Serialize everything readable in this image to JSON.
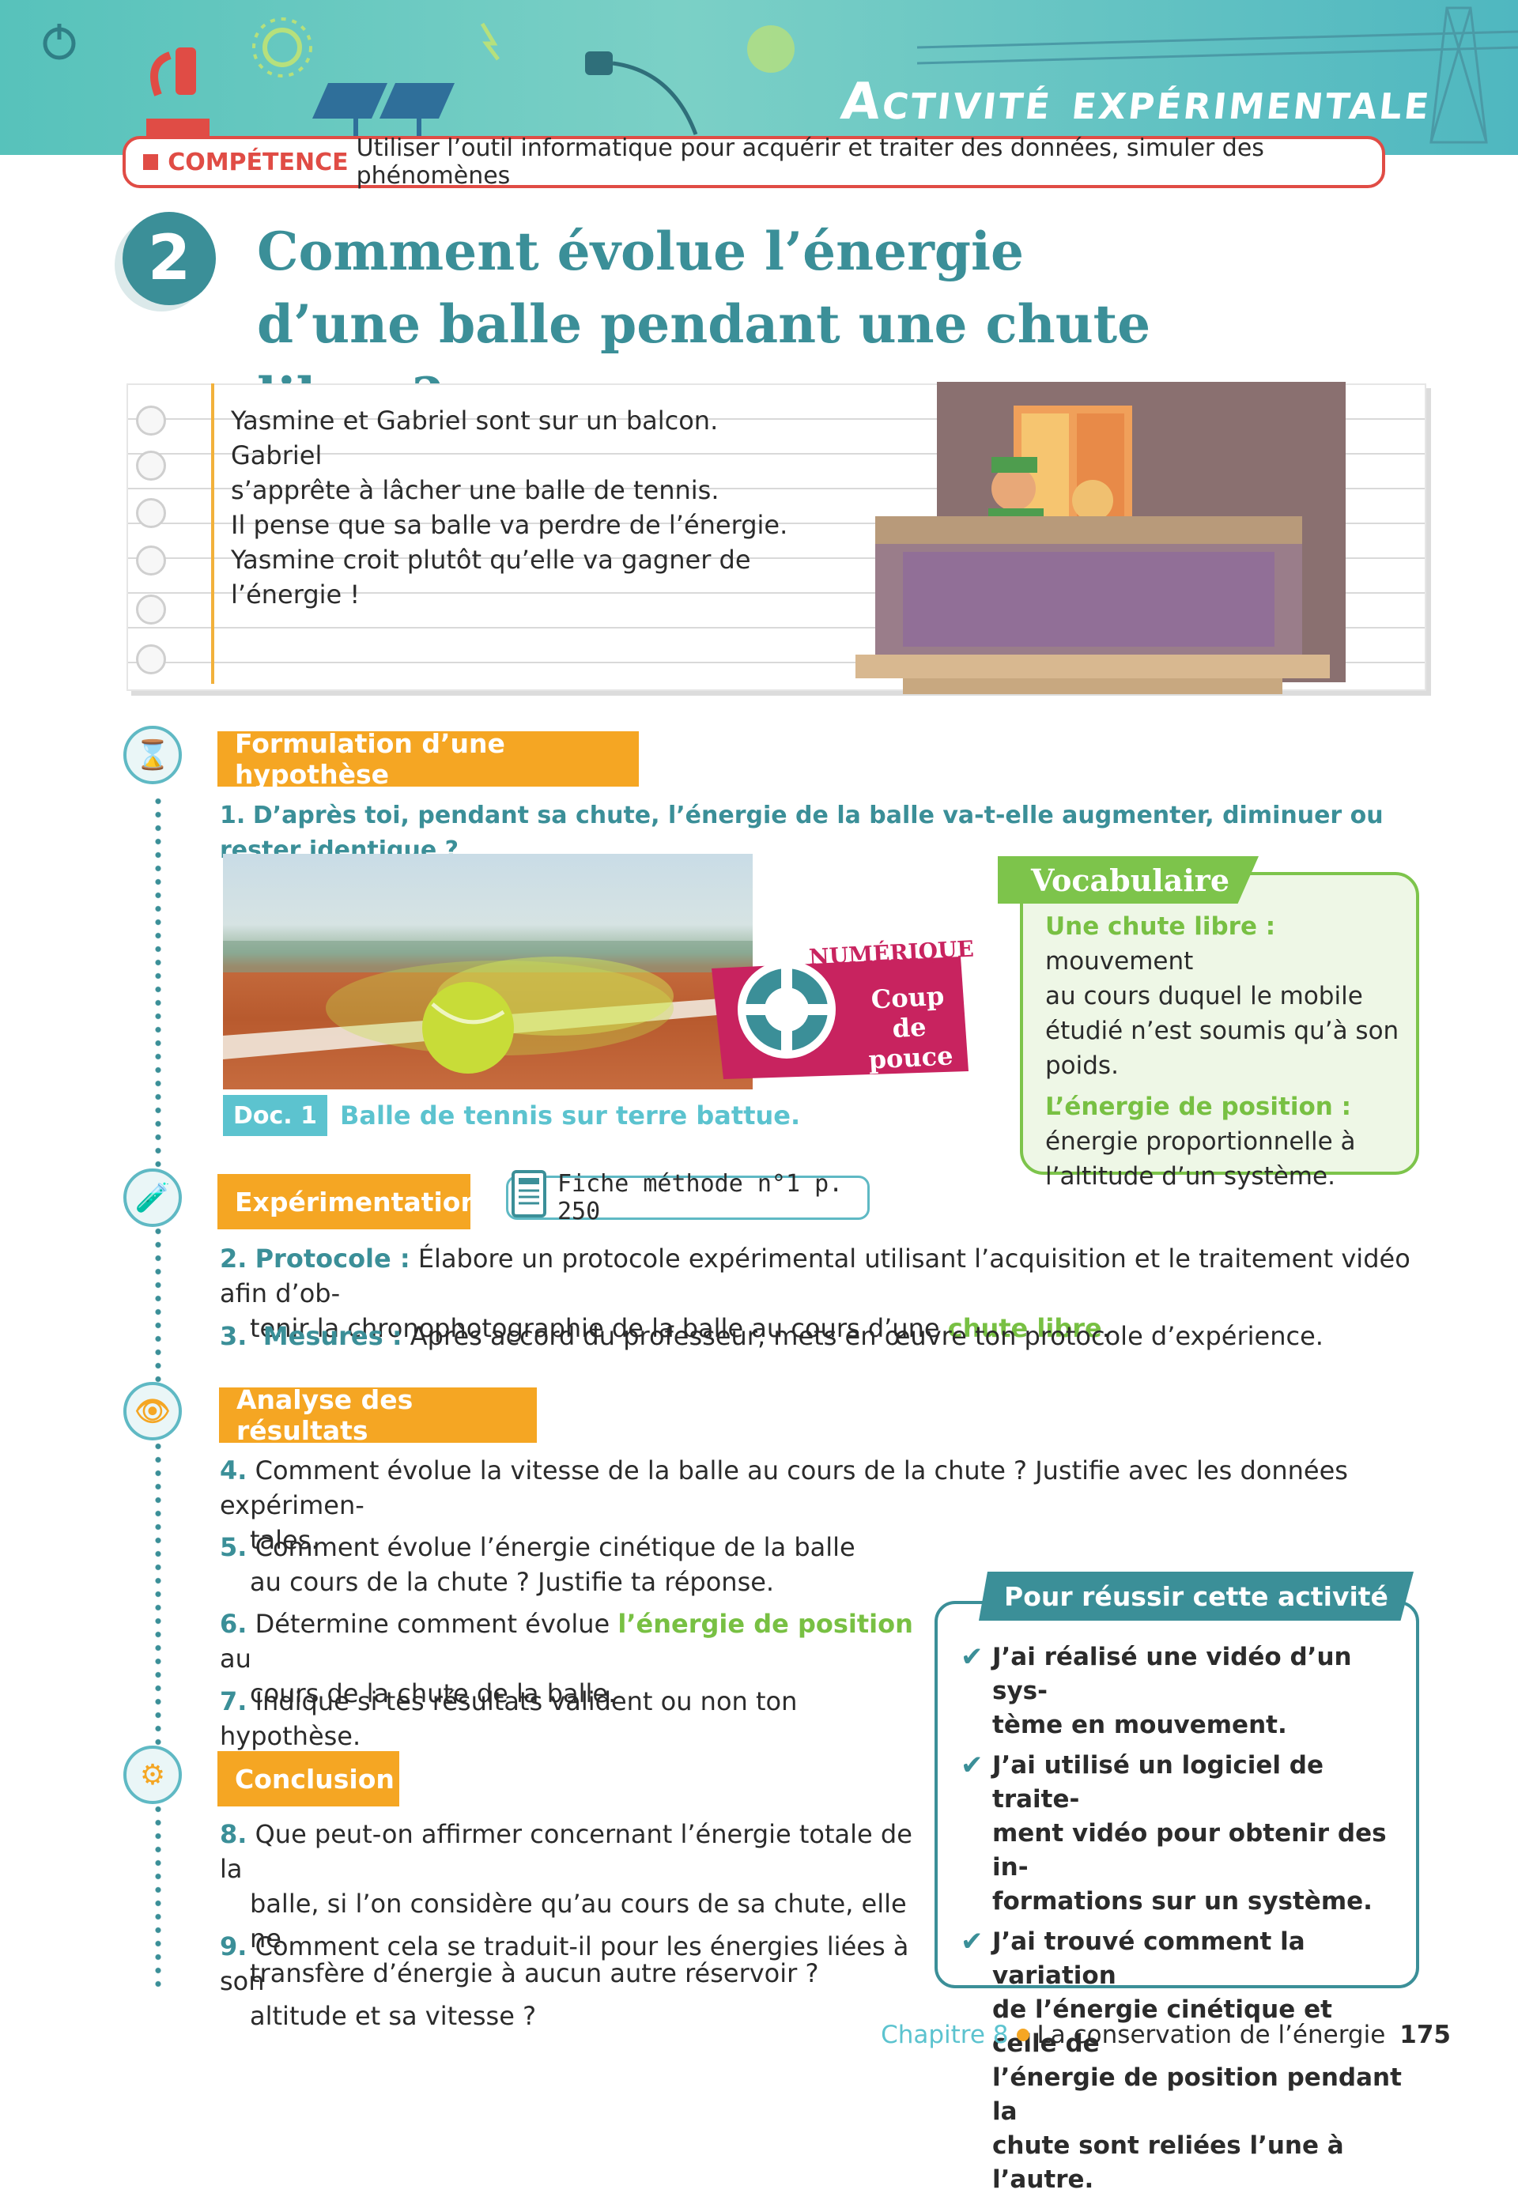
{
  "header": {
    "banner_title": "Activité expérimentale",
    "competence_label": "COMPÉTENCE",
    "competence_text": "Utiliser l’outil informatique pour acquérir et traiter des données, simuler des phénomènes"
  },
  "activity": {
    "number": "2",
    "title_line1": "Comment évolue l’énergie",
    "title_line2": "d’une balle pendant une chute libre ?"
  },
  "intro": {
    "lines": [
      "Yasmine et Gabriel sont sur un balcon. Gabriel",
      "s’apprête à lâcher une balle de tennis.",
      "Il pense que sa balle va perdre de l’énergie.",
      "Yasmine croit plutôt qu’elle va gagner de",
      "l’énergie !"
    ]
  },
  "sections": {
    "hypothesis": {
      "title": "Formulation d’une hypothèse",
      "q1_num": "1.",
      "q1_text": "D’après toi, pendant sa chute, l’énergie de la balle va-t-elle augmenter, diminuer ou rester identique ?"
    },
    "experimentation": {
      "title": "Expérimentation",
      "fiche": "Fiche méthode n°1 p. 250",
      "q2_num": "2.",
      "q2_label": "Protocole :",
      "q2_text_a": " Élabore un protocole expérimental utilisant l’acquisition et le traitement vidéo afin d’ob-",
      "q2_text_b": "tenir la chronophotographie de la balle au cours d’une ",
      "q2_link": "chute libre",
      "q2_end": ".",
      "q3_num": "3.",
      "q3_label": "Mesures :",
      "q3_text": " Après accord du professeur, mets en œuvre ton protocole d’expérience."
    },
    "analysis": {
      "title": "Analyse des résultats",
      "q4_num": "4.",
      "q4_a": "Comment évolue la vitesse de la balle au cours de la chute ? Justifie avec les données expérimen-",
      "q4_b": "tales.",
      "q5_num": "5.",
      "q5_a": "Comment évolue l’énergie cinétique de la balle",
      "q5_b": "au cours de la chute ? Justifie ta réponse.",
      "q6_num": "6.",
      "q6_a": "Détermine comment évolue ",
      "q6_link": "l’énergie de position",
      "q6_b": " au",
      "q6_c": "cours de la chute de la balle.",
      "q7_num": "7.",
      "q7_text": "Indique si tes résultats valident ou non ton hypothèse."
    },
    "conclusion": {
      "title": "Conclusion",
      "q8_num": "8.",
      "q8_a": "Que peut-on affirmer concernant l’énergie totale de la",
      "q8_b": "balle, si l’on considère qu’au cours de sa chute, elle ne",
      "q8_c": "transfère d’énergie à aucun autre réservoir ?",
      "q9_num": "9.",
      "q9_a": "Comment cela se traduit-il pour les énergies liées à son",
      "q9_b": "altitude et sa vitesse ?"
    }
  },
  "doc1": {
    "label": "Doc. 1",
    "caption": "Balle de tennis sur terre battue."
  },
  "numerique": {
    "label": "NUMÉRIQUE",
    "line1": "Coup",
    "line2": "de pouce"
  },
  "vocabulary": {
    "title": "Vocabulaire",
    "term1": "Une chute libre :",
    "def1_a": " mouvement",
    "def1_b": "au cours duquel le mobile",
    "def1_c": "étudié n’est soumis qu’à son",
    "def1_d": "poids.",
    "term2": "L’énergie de position :",
    "def2_a": "énergie proportionnelle à",
    "def2_b": "l’altitude d’un système."
  },
  "success": {
    "title": "Pour réussir cette activité",
    "items": [
      [
        "J’ai réalisé une vidéo d’un sys-",
        "tème en mouvement."
      ],
      [
        "J’ai utilisé un logiciel de traite-",
        "ment vidéo pour obtenir des in-",
        "formations sur un système."
      ],
      [
        "J’ai trouvé comment la variation",
        "de l’énergie cinétique et celle de",
        "l’énergie de position pendant la",
        "chute sont reliées l’une à l’autre."
      ]
    ]
  },
  "footer": {
    "chapter": "Chapitre 8",
    "title": "La conservation de l’énergie",
    "page": "175"
  },
  "colors": {
    "teal": "#3b8f98",
    "orange": "#f5a623",
    "green": "#78c043",
    "red": "#e04c45",
    "light_blue": "#5cc3cf"
  }
}
